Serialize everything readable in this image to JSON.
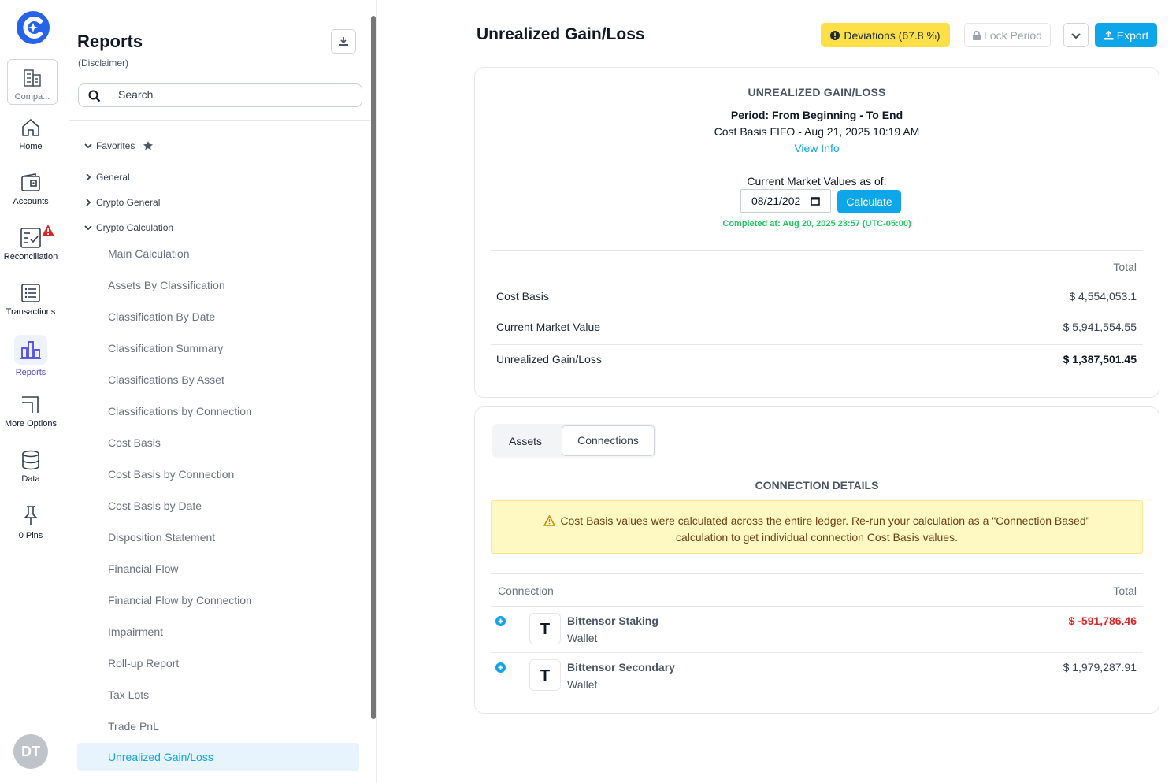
{
  "rail": {
    "company_label": "Compa...",
    "items": [
      {
        "label": "Home",
        "icon": "home-icon"
      },
      {
        "label": "Accounts",
        "icon": "wallet-icon"
      },
      {
        "label": "Reconciliation",
        "icon": "checklist-icon"
      },
      {
        "label": "Transactions",
        "icon": "list-icon"
      },
      {
        "label": "Reports",
        "icon": "bar-chart-icon"
      },
      {
        "label": "More Options",
        "icon": "corner-icon"
      },
      {
        "label": "Data",
        "icon": "database-icon"
      },
      {
        "label": "0 Pins",
        "icon": "pin-icon"
      }
    ],
    "avatar": "DT",
    "colors": {
      "accent": "#4f46e5",
      "alert": "#dc2626"
    }
  },
  "sidebar": {
    "title": "Reports",
    "subtitle": "(Disclaimer)",
    "search_placeholder": "Search",
    "groups": [
      {
        "label": "Favorites",
        "expanded": true
      },
      {
        "label": "General",
        "expanded": false
      },
      {
        "label": "Crypto General",
        "expanded": false
      },
      {
        "label": "Crypto Calculation",
        "expanded": true
      }
    ],
    "items": [
      "Main Calculation",
      "Assets By Classification",
      "Classification By Date",
      "Classification Summary",
      "Classifications By Asset",
      "Classifications by Connection",
      "Cost Basis",
      "Cost Basis by Connection",
      "Cost Basis by Date",
      "Disposition Statement",
      "Financial Flow",
      "Financial Flow by Connection",
      "Impairment",
      "Roll-up Report",
      "Tax Lots",
      "Trade PnL"
    ],
    "active_item": "Unrealized Gain/Loss"
  },
  "header": {
    "title": "Unrealized Gain/Loss",
    "deviations": "Deviations (67.8 %)",
    "lock_period": "Lock Period",
    "export": "Export",
    "colors": {
      "deviation_bg": "#fde047",
      "primary": "#0ea5e9"
    }
  },
  "summary": {
    "title": "UNREALIZED GAIN/LOSS",
    "period": "Period: From Beginning - To End",
    "basis": "Cost Basis FIFO - Aug 21, 2025 10:19 AM",
    "view_info": "View Info",
    "market_values_label": "Current Market Values as of:",
    "date_value": "08/21/202",
    "calculate": "Calculate",
    "completed": "Completed at: Aug 20, 2025 23:57 (UTC-05:00)",
    "total_header": "Total",
    "rows": [
      {
        "label": "Cost Basis",
        "value": "$ 4,554,053.1"
      },
      {
        "label": "Current Market Value",
        "value": "$ 5,941,554.55"
      },
      {
        "label": "Unrealized Gain/Loss",
        "value": "$ 1,387,501.45"
      }
    ]
  },
  "connections": {
    "tabs": [
      "Assets",
      "Connections"
    ],
    "active_tab": "Connections",
    "title": "CONNECTION DETAILS",
    "warning_line1": "Cost Basis values were calculated across the entire ledger. Re-run your calculation as a \"Connection Based\"",
    "warning_line2": "calculation to get individual connection Cost Basis values.",
    "col_connection": "Connection",
    "col_total": "Total",
    "rows": [
      {
        "token": "T",
        "name": "Bittensor Staking",
        "type": "Wallet",
        "total": "$ -591,786.46",
        "negative": true
      },
      {
        "token": "T",
        "name": "Bittensor Secondary",
        "type": "Wallet",
        "total": "$ 1,979,287.91",
        "negative": false
      }
    ]
  }
}
